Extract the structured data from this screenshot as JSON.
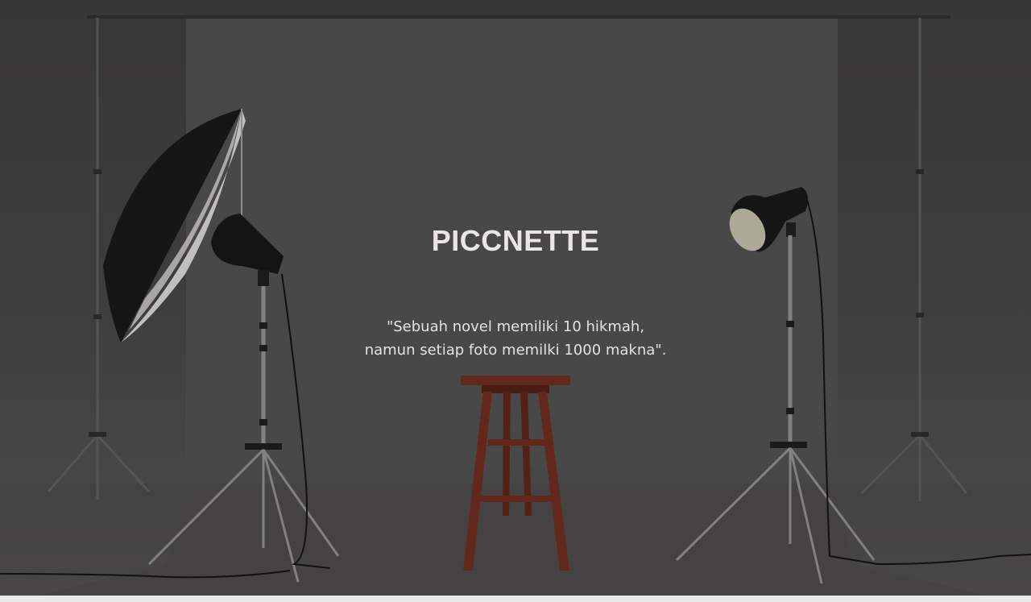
{
  "hero": {
    "brand": "PICCNETTE",
    "quote_line_1": "\"Sebuah novel memiliki 10 hikmah,",
    "quote_line_2": "namun setiap foto memilki 1000 makna\"."
  },
  "colors": {
    "backdrop": "#4a494a",
    "stool": "#6a2a1c",
    "text": "#ebe6e6"
  }
}
